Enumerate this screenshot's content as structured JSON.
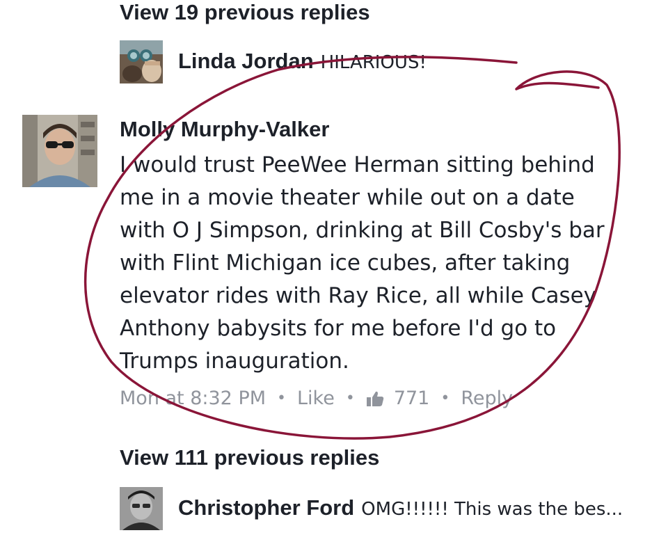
{
  "thread_top": {
    "view_replies_label": "View 19 previous replies"
  },
  "reply_top": {
    "author": "Linda Jordan",
    "text": "HILARIOUS!"
  },
  "main_comment": {
    "author": "Molly Murphy-Valker",
    "lines": [
      "I would trust PeeWee Herman sitting behind",
      "me in a movie theater while out on a date",
      "with O J Simpson, drinking at Bill Cosby's bar",
      "with Flint Michigan ice cubes, after taking",
      "elevator rides with Ray Rice, all while Casey",
      "Anthony babysits for me before I'd go to",
      "Trumps inauguration."
    ],
    "timestamp": "Mon at 8:32 PM",
    "like_label": "Like",
    "like_count": "771",
    "reply_label": "Reply"
  },
  "thread_bottom": {
    "view_replies_label": "View 111 previous replies"
  },
  "reply_bottom": {
    "author": "Christopher Ford",
    "text": "OMG!!!!!! This was the bes..."
  },
  "icons": {
    "like": "thumbs-up-icon",
    "separator": "dot-separator"
  },
  "colors": {
    "text": "#1d2129",
    "meta_text": "#90949c",
    "annotation": "#8a1538"
  }
}
